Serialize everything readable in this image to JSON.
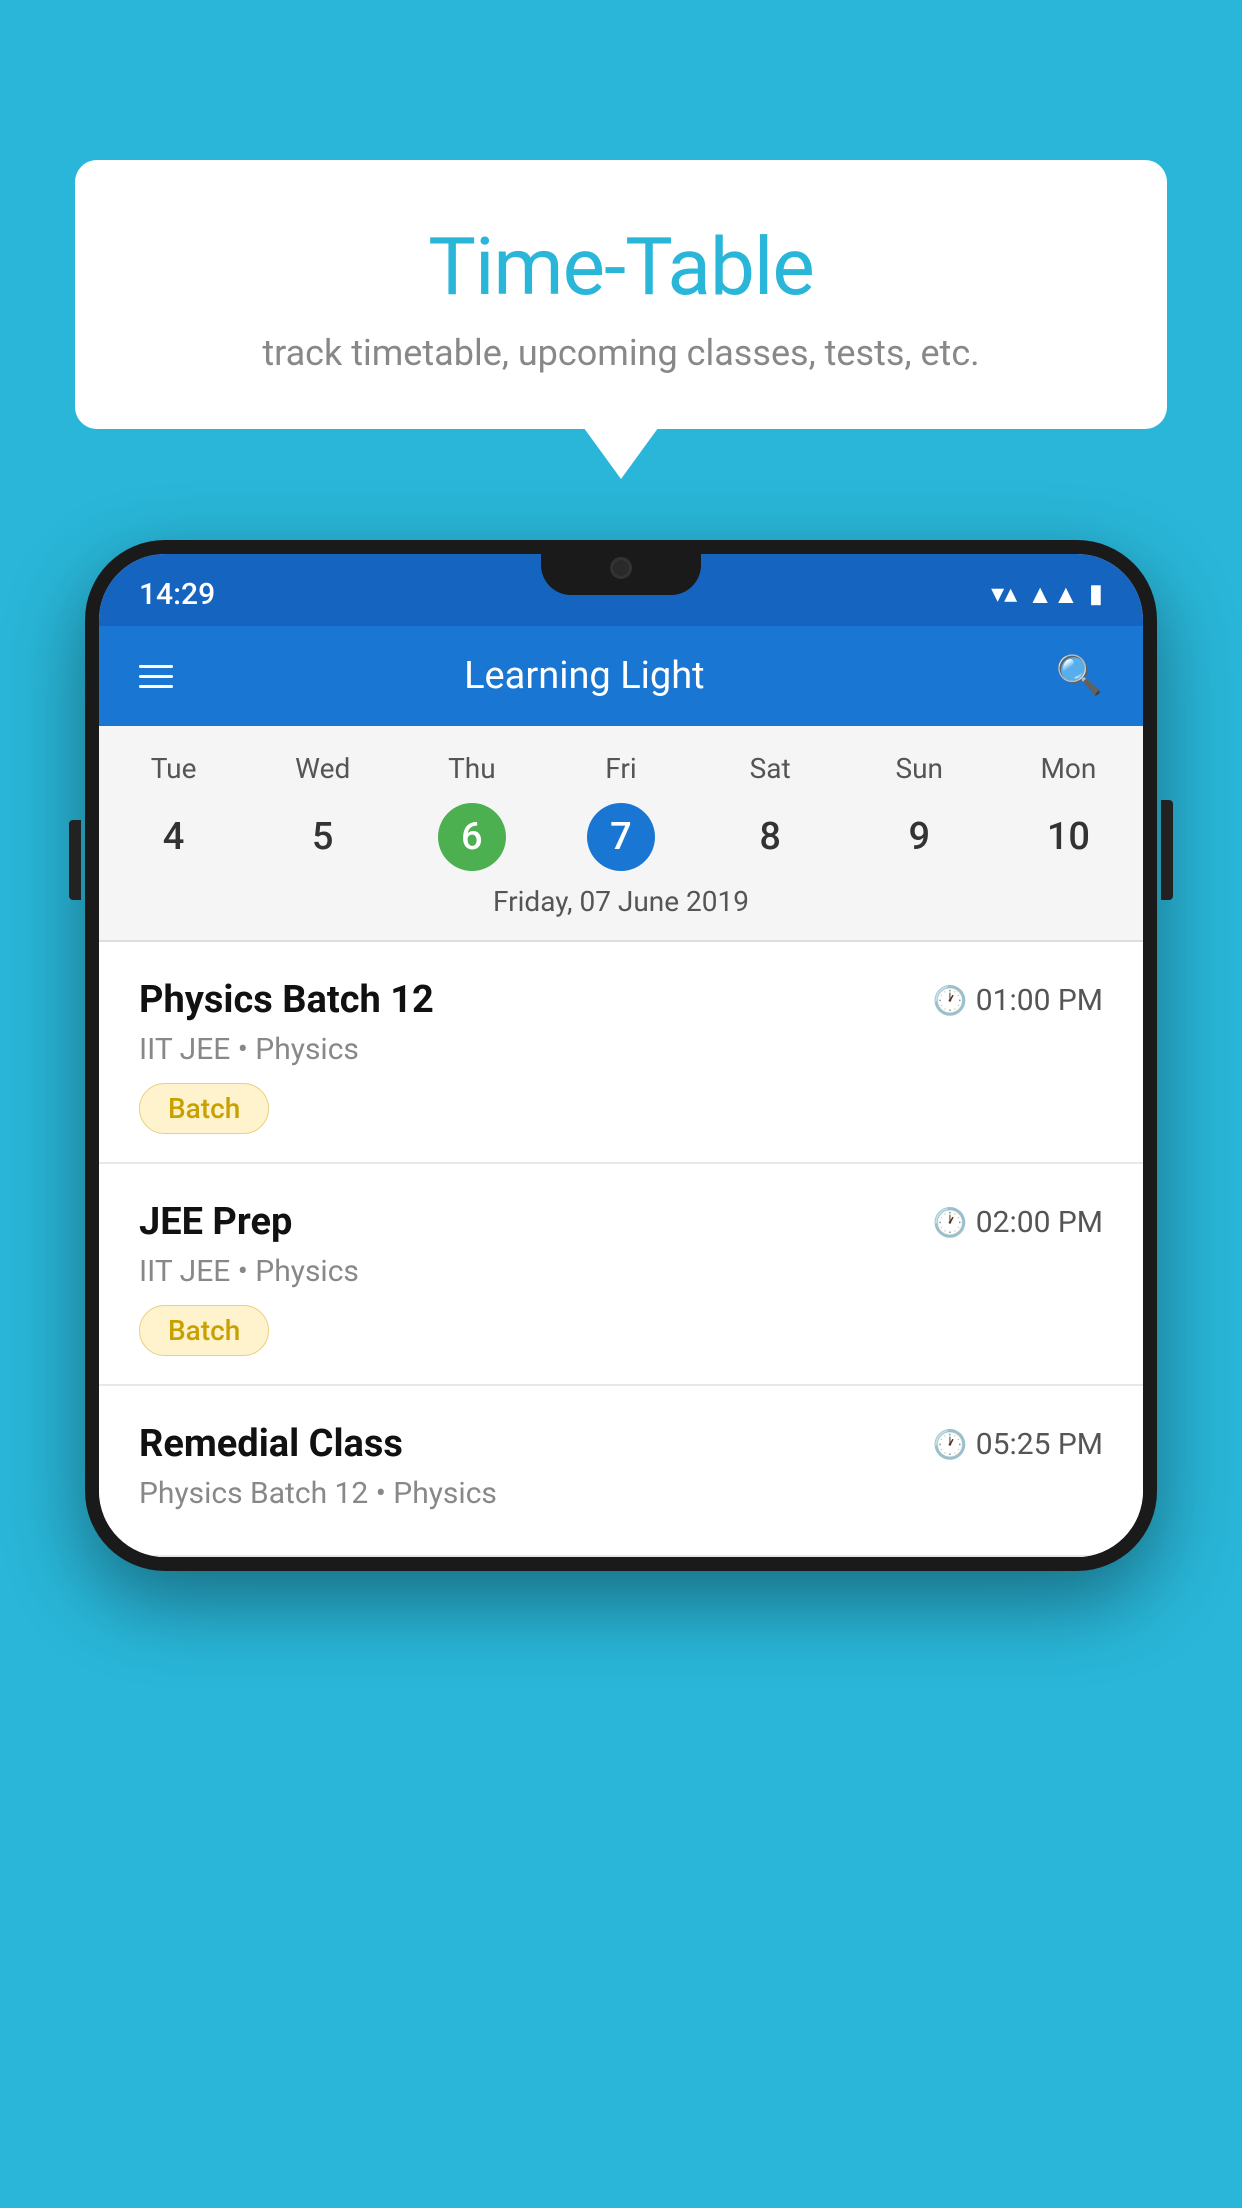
{
  "background_color": "#29B6D8",
  "bubble": {
    "title": "Time-Table",
    "subtitle": "track timetable, upcoming classes, tests, etc."
  },
  "phone": {
    "status_bar": {
      "time": "14:29",
      "icons": [
        "wifi",
        "signal",
        "battery"
      ]
    },
    "app_bar": {
      "title": "Learning Light",
      "menu_icon_label": "menu",
      "search_icon_label": "search"
    },
    "calendar": {
      "days": [
        {
          "label": "Tue",
          "number": "4"
        },
        {
          "label": "Wed",
          "number": "5"
        },
        {
          "label": "Thu",
          "number": "6",
          "state": "today"
        },
        {
          "label": "Fri",
          "number": "7",
          "state": "selected"
        },
        {
          "label": "Sat",
          "number": "8"
        },
        {
          "label": "Sun",
          "number": "9"
        },
        {
          "label": "Mon",
          "number": "10"
        }
      ],
      "selected_date_label": "Friday, 07 June 2019"
    },
    "schedule": [
      {
        "title": "Physics Batch 12",
        "time": "01:00 PM",
        "meta": "IIT JEE • Physics",
        "badge": "Batch"
      },
      {
        "title": "JEE Prep",
        "time": "02:00 PM",
        "meta": "IIT JEE • Physics",
        "badge": "Batch"
      },
      {
        "title": "Remedial Class",
        "time": "05:25 PM",
        "meta": "Physics Batch 12 • Physics",
        "badge": null
      }
    ]
  }
}
